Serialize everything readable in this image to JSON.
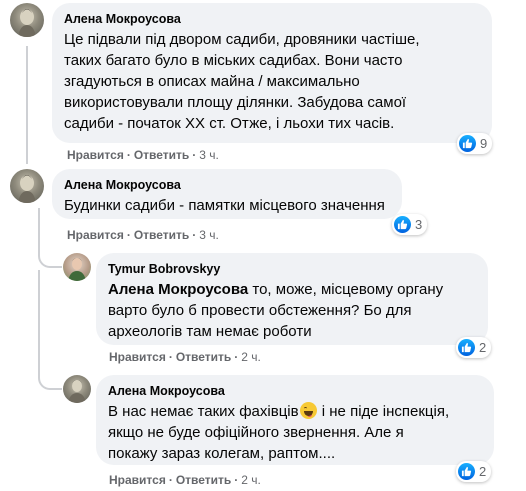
{
  "comments": [
    {
      "author": "Алена Мокроусова",
      "text": "Це підвали під двором садиби, дровяники частіше,\nтаких багато було в міських садибах. Вони часто\nзгадуються в описах майна / максимально\nвикористовували площу ділянки. Забудова самої\nсадиби - початок ХХ ст. Отже, і льохи тих часів.",
      "like": "Нравится",
      "reply": "Ответить",
      "time": "3 ч.",
      "reactions": "9"
    },
    {
      "author": "Алена Мокроусова",
      "text": "Будинки садиби - памятки місцевого значення",
      "like": "Нравится",
      "reply": "Ответить",
      "time": "3 ч.",
      "reactions": "3"
    },
    {
      "author": "Tymur Bobrovskyy",
      "mention": "Алена Мокроусова",
      "text": " то, може, місцевому органу\nварто було б провести обстеження? Бо для\nархеологів там немає роботи",
      "like": "Нравится",
      "reply": "Ответить",
      "time": "2 ч.",
      "reactions": "2"
    },
    {
      "author": "Алена Мокроусова",
      "text_a": "В нас немає таких фахівців",
      "emoji": "squinting-tongue-emoji",
      "text_b": " і не піде інспекція,\nякщо не буде офіційного звернення. Але я\nпокажу зараз колегам, раптом....",
      "like": "Нравится",
      "reply": "Ответить",
      "time": "2 ч.",
      "reactions": "2"
    }
  ],
  "separator": "·",
  "colors": {
    "bubble": "#f0f2f5",
    "meta": "#65676b",
    "like_blue": "#1877f2"
  }
}
